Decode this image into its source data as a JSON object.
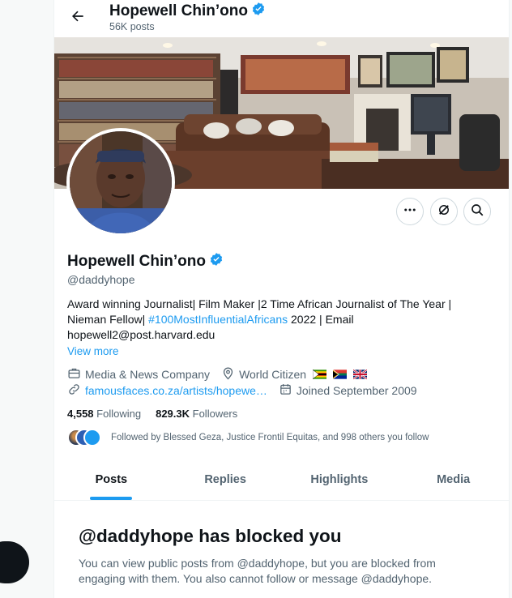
{
  "header": {
    "title": "Hopewell Chin’ono",
    "post_count": "56K posts",
    "back_icon": "arrow-left-icon"
  },
  "profile": {
    "display_name": "Hopewell Chin’ono",
    "handle": "@daddyhope",
    "verified_color": "#1d9bf0",
    "bio_part1": "Award winning Journalist| Film Maker |2 Time African Journalist of The Year | Nieman Fellow| ",
    "bio_hashtag": "#100MostInfluentialAfricans",
    "bio_part2": " 2022 | Email hopewell2@post.harvard.edu",
    "view_more": "View more",
    "category": "Media & News Company",
    "location": "World Citizen",
    "website": "famousfaces.co.za/artists/hopewe…",
    "joined": "Joined September 2009",
    "following_count": "4,558",
    "following_label": "Following",
    "followers_count": "829.3K",
    "followers_label": "Followers",
    "followed_by": "Followed by Blessed Geza, Justice Frontil Equitas, and 998 others you follow"
  },
  "actions": {
    "more_icon": "more-dots-icon",
    "grok_icon": "grok-icon",
    "search_icon": "search-icon"
  },
  "tabs": [
    {
      "label": "Posts",
      "active": true
    },
    {
      "label": "Replies",
      "active": false
    },
    {
      "label": "Highlights",
      "active": false
    },
    {
      "label": "Media",
      "active": false
    }
  ],
  "blocked": {
    "title": "@daddyhope has blocked you",
    "text": "You can view public posts from @daddyhope, but you are blocked from engaging with them. You also cannot follow or message @daddyhope."
  },
  "colors": {
    "accent": "#1d9bf0",
    "text": "#0f1419",
    "muted": "#536471"
  }
}
